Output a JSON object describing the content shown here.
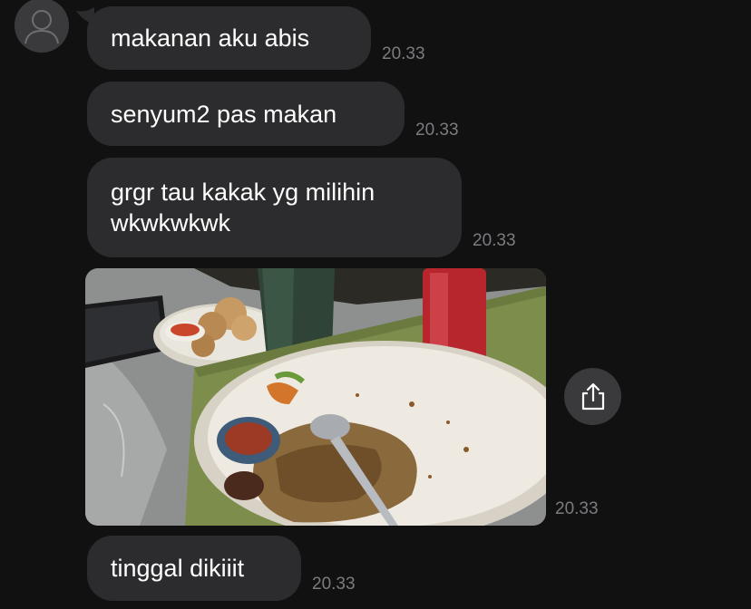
{
  "messages": [
    {
      "text": "makanan aku abis",
      "time": "20.33"
    },
    {
      "text": "senyum2 pas makan",
      "time": "20.33"
    },
    {
      "text_line1": "grgr tau kakak yg milihin",
      "text_line2": "wkwkwkwk",
      "time": "20.33"
    },
    {
      "type": "image",
      "description": "food-photo",
      "time": "20.33"
    },
    {
      "text": "tinggal dikiiit",
      "time": "20.33"
    }
  ],
  "icons": {
    "avatar": "person-silhouette-icon",
    "share": "share-icon"
  },
  "colors": {
    "background": "#111112",
    "bubble": "#2c2c2e",
    "text": "#ffffff",
    "timestamp": "#7c7c80"
  }
}
